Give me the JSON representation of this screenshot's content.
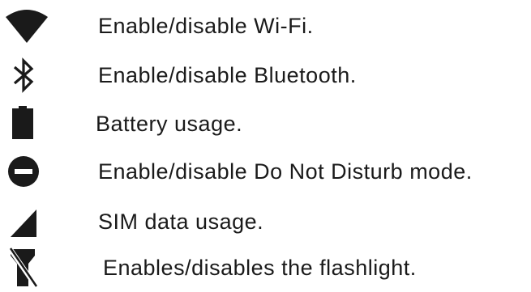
{
  "legend": {
    "items": [
      {
        "icon": "wifi-icon",
        "label": "Enable/disable Wi-Fi."
      },
      {
        "icon": "bluetooth-icon",
        "label": "Enable/disable Bluetooth."
      },
      {
        "icon": "battery-icon",
        "label": "Battery usage."
      },
      {
        "icon": "do-not-disturb-icon",
        "label": "Enable/disable Do Not Disturb mode."
      },
      {
        "icon": "sim-signal-icon",
        "label": "SIM data usage."
      },
      {
        "icon": "flashlight-icon",
        "label": "Enables/disables the flashlight."
      }
    ]
  },
  "colors": {
    "icon": "#1a1a1a",
    "text": "#1a1a1a",
    "background": "#ffffff"
  }
}
